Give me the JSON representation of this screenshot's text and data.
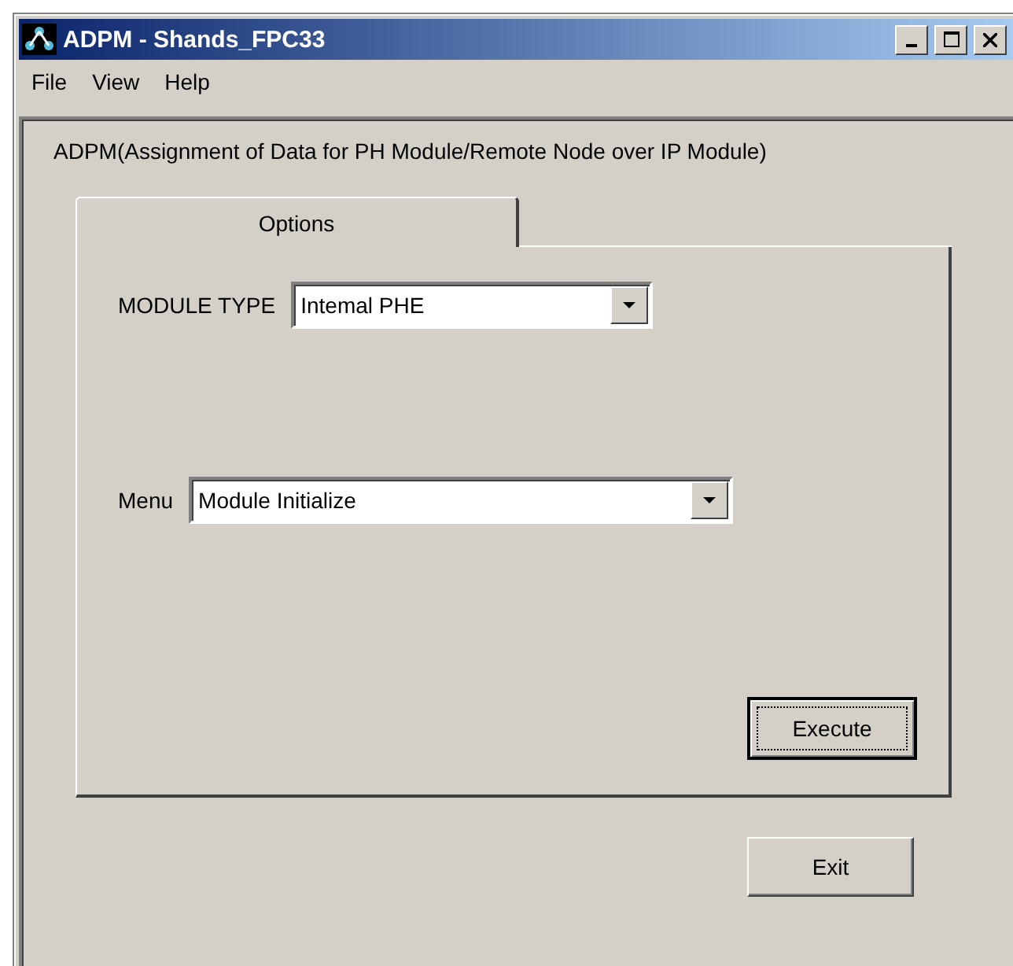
{
  "window": {
    "title": "ADPM - Shands_FPC33"
  },
  "menu": [
    {
      "label": "File"
    },
    {
      "label": "View"
    },
    {
      "label": "Help"
    }
  ],
  "description": "ADPM(Assignment of Data for PH Module/Remote Node over IP Module)",
  "tabs": [
    {
      "label": "Options",
      "selected": true
    }
  ],
  "fields": [
    {
      "label": "MODULE TYPE",
      "value": "Intemal PHE"
    },
    {
      "label": "Menu",
      "value": "Module Initialize"
    }
  ],
  "buttons": [
    {
      "label": "Execute",
      "default": true
    },
    {
      "label": "Exit",
      "default": false
    }
  ]
}
